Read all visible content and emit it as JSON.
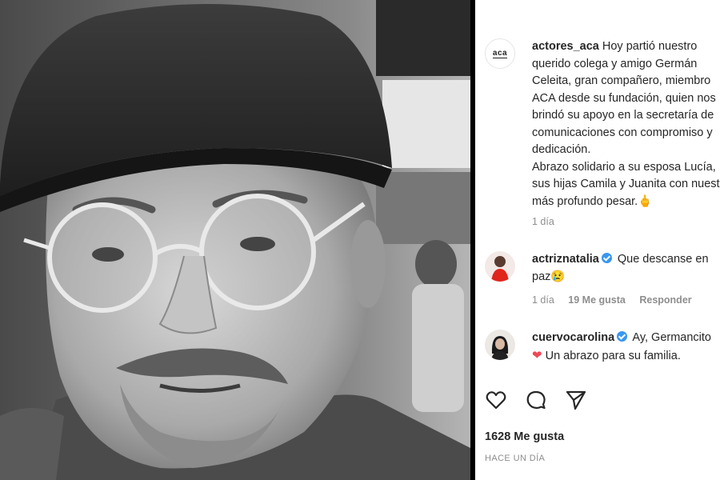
{
  "post": {
    "caption": {
      "username": "actores_aca",
      "avatar_text": "aca",
      "lines": [
        "Hoy partió nuestro",
        "querido colega y amigo Germán",
        "Celeita, gran compañero, miembro",
        "ACA desde su fundación, quien nos",
        "brindó su apoyo en la secretaría de",
        "comunicaciones con compromiso y",
        "dedicación.",
        "Abrazo solidario a su esposa Lucía,",
        "sus hijas Camila y Juanita con nuestro",
        "más profundo pesar.🖕"
      ],
      "time": "1 día"
    },
    "comments": [
      {
        "username": "actriznatalia",
        "verified": true,
        "text_line1": "Que descanse en",
        "text_line2": "paz😢",
        "time": "1 día",
        "likes": "19 Me gusta",
        "reply": "Responder"
      },
      {
        "username": "cuervocarolina",
        "verified": true,
        "text_line1": "Ay, Germancito",
        "heart": "❤",
        "text_line2": "Un abrazo para su familia."
      }
    ],
    "action_icons": [
      "heart-outline-icon",
      "comment-icon",
      "share-icon"
    ],
    "likes_count": "1628 Me gusta",
    "posted_ago": "HACE UN DÍA"
  },
  "colors": {
    "verified": "#3897f0",
    "text": "#262626",
    "muted": "#8e8e8e",
    "heart": "#ed4956"
  }
}
